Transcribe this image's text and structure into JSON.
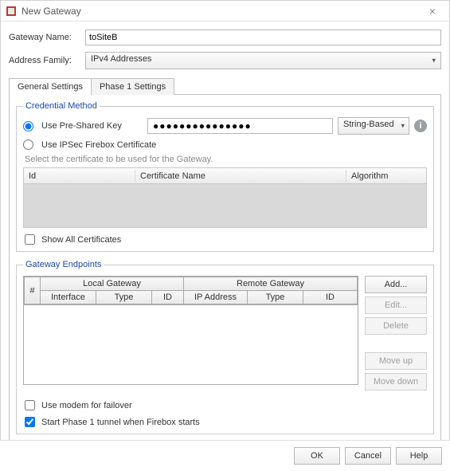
{
  "window": {
    "title": "New Gateway",
    "close_glyph": "×"
  },
  "fields": {
    "gateway_name_label": "Gateway Name:",
    "gateway_name_value": "toSiteB",
    "address_family_label": "Address Family:",
    "address_family_value": "IPv4 Addresses"
  },
  "tabs": {
    "general": "General Settings",
    "phase1": "Phase 1 Settings"
  },
  "credential": {
    "legend": "Credential Method",
    "use_psk_label": "Use Pre-Shared Key",
    "psk_value": "●●●●●●●●●●●●●●●",
    "psk_type": "String-Based",
    "use_cert_label": "Use IPSec Firebox Certificate",
    "hint": "Select the certificate to be used for the Gateway.",
    "col_id": "Id",
    "col_name": "Certificate Name",
    "col_alg": "Algorithm",
    "show_all_label": "Show All Certificates"
  },
  "endpoints": {
    "legend": "Gateway Endpoints",
    "hash": "#",
    "local_header": "Local Gateway",
    "remote_header": "Remote Gateway",
    "col_interface": "Interface",
    "col_type": "Type",
    "col_id": "ID",
    "col_ip": "IP Address",
    "buttons": {
      "add": "Add...",
      "edit": "Edit...",
      "delete": "Delete",
      "move_up": "Move up",
      "move_down": "Move down"
    }
  },
  "options": {
    "use_modem": "Use modem for failover",
    "start_phase1": "Start Phase 1 tunnel when Firebox starts"
  },
  "footer": {
    "ok": "OK",
    "cancel": "Cancel",
    "help": "Help"
  }
}
